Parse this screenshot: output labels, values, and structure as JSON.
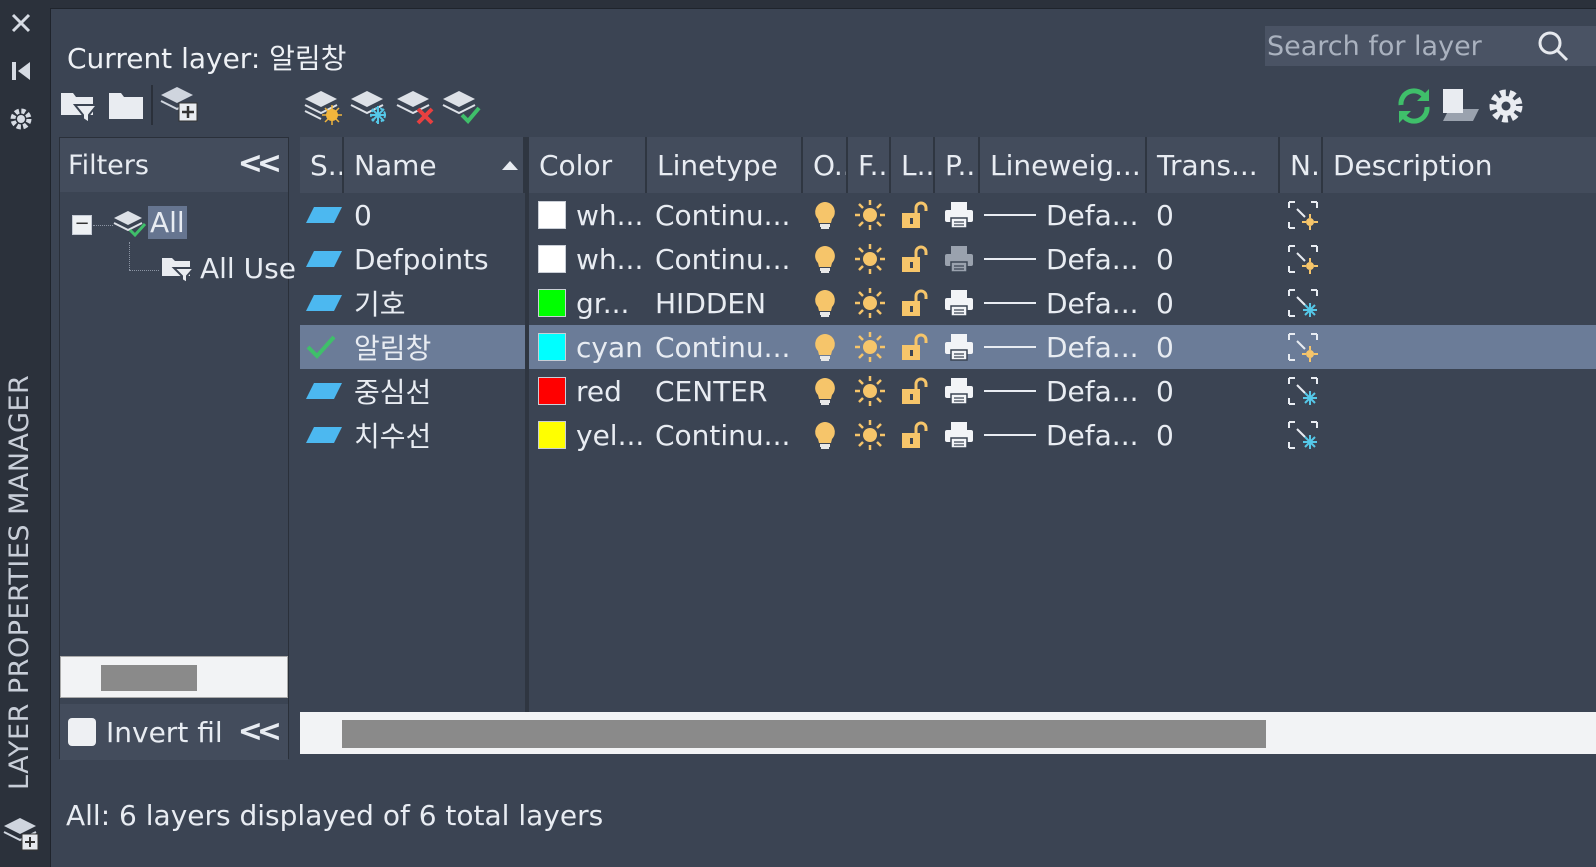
{
  "window": {
    "vertical_title": "LAYER PROPERTIES MANAGER"
  },
  "header": {
    "current_layer": "Current layer: 알림창",
    "search_placeholder": "Search for layer"
  },
  "filters": {
    "title": "Filters",
    "tree": [
      {
        "label": "All",
        "selected": true
      },
      {
        "label": "All Use"
      }
    ],
    "invert_label": "Invert fil",
    "invert_checked": false,
    "scroll_fraction": 0.35
  },
  "columns": [
    "S..",
    "Name",
    "Color",
    "Linetype",
    "O..",
    "F..",
    "L..",
    "P..",
    "Lineweig...",
    "Trans...",
    "N..",
    "Description"
  ],
  "layers": [
    {
      "status": "layer",
      "name": "0",
      "color": "#ffffff",
      "color_name": "wh...",
      "linetype": "Continu...",
      "lineweight": "Defa...",
      "transparency": "0",
      "plot": true,
      "selected": false
    },
    {
      "status": "layer",
      "name": "Defpoints",
      "color": "#ffffff",
      "color_name": "wh...",
      "linetype": "Continu...",
      "lineweight": "Defa...",
      "transparency": "0",
      "plot": false,
      "selected": false
    },
    {
      "status": "layer",
      "name": "기호",
      "color": "#00ff00",
      "color_name": "gr...",
      "linetype": "HIDDEN",
      "lineweight": "Defa...",
      "transparency": "0",
      "plot": true,
      "selected": false
    },
    {
      "status": "current",
      "name": "알림창",
      "color": "#00ffff",
      "color_name": "cyan",
      "linetype": "Continu...",
      "lineweight": "Defa...",
      "transparency": "0",
      "plot": true,
      "selected": true
    },
    {
      "status": "layer",
      "name": "중심선",
      "color": "#ff0000",
      "color_name": "red",
      "linetype": "CENTER",
      "lineweight": "Defa...",
      "transparency": "0",
      "plot": true,
      "selected": false
    },
    {
      "status": "layer",
      "name": "치수선",
      "color": "#ffff00",
      "color_name": "yel...",
      "linetype": "Continu...",
      "lineweight": "Defa...",
      "transparency": "0",
      "plot": true,
      "selected": false
    }
  ],
  "status_bar": "All: 6 layers displayed of 6 total layers",
  "colors": {
    "panel": "#3b4453",
    "header": "#434c5c",
    "selection": "#6b7c98",
    "bulb": "#f6c56a",
    "refresh": "#3fbf6a"
  }
}
